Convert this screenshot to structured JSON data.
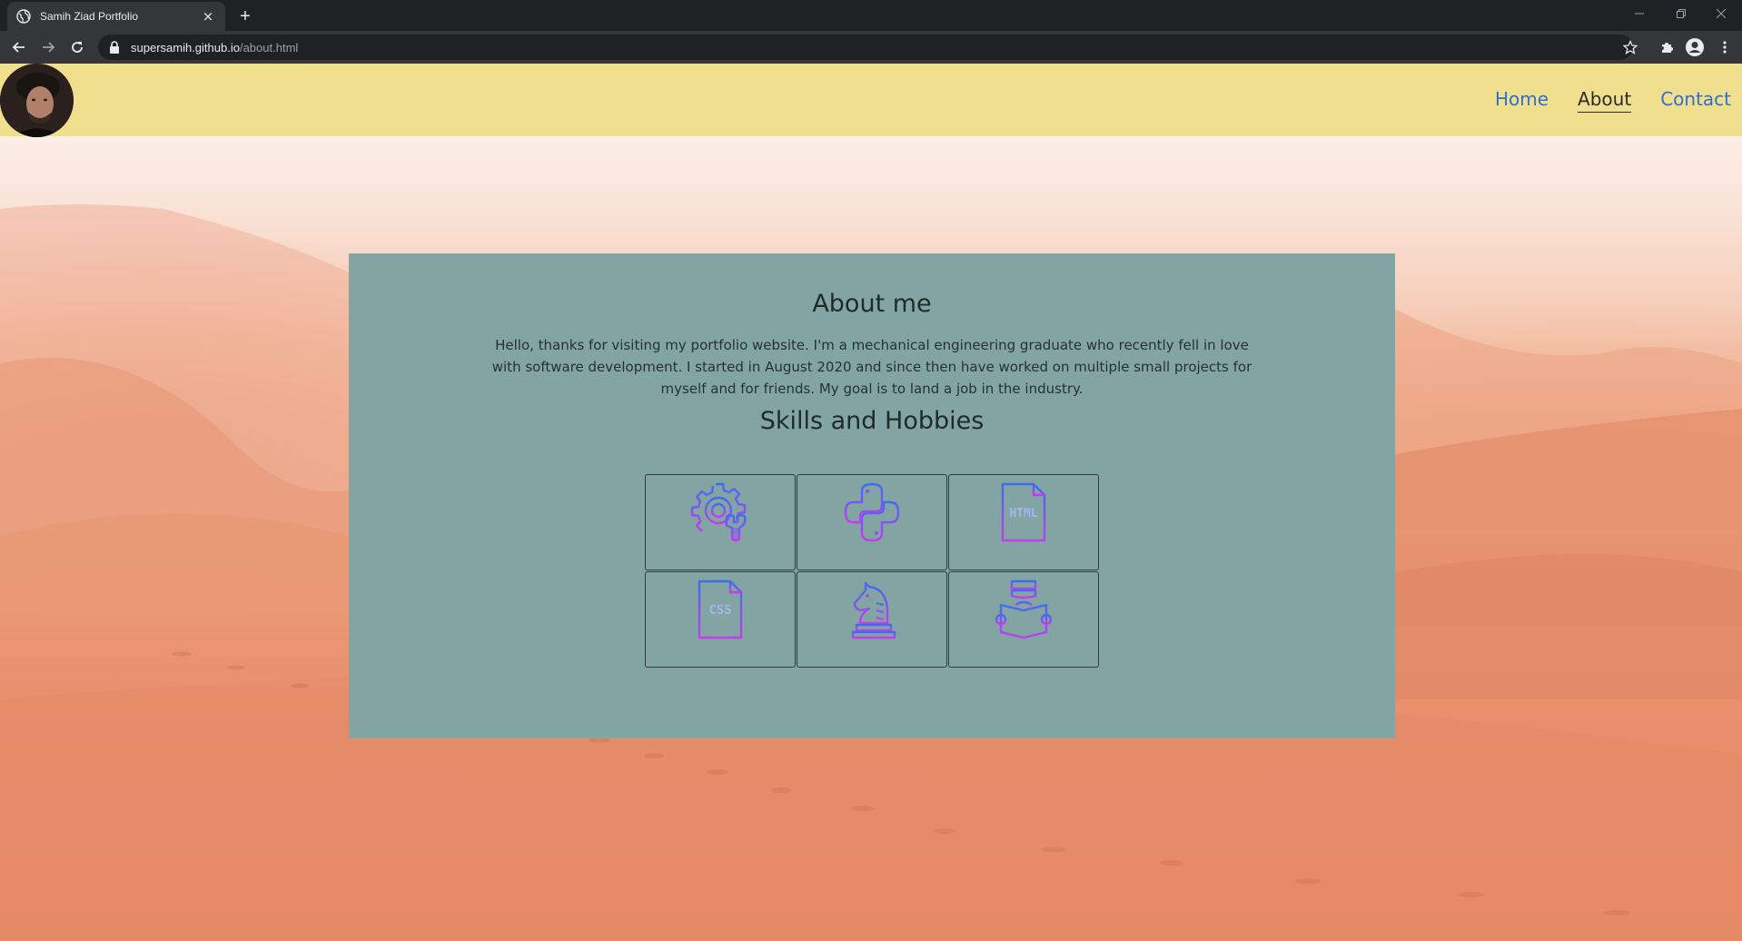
{
  "browser": {
    "tab_title": "Samih Ziad Portfolio",
    "url_host": "supersamih.github.io",
    "url_path": "/about.html"
  },
  "navbar": {
    "links": [
      {
        "label": "Home",
        "active": false
      },
      {
        "label": "About",
        "active": true
      },
      {
        "label": "Contact",
        "active": false
      }
    ]
  },
  "about": {
    "title": "About me",
    "text": "Hello, thanks for visiting my portfolio website. I'm a mechanical engineering graduate who recently fell in love with software development. I started in August 2020 and since then have worked on multiple small projects for myself and for friends. My goal is to land a job in the industry."
  },
  "skills": {
    "title": "Skills and Hobbies",
    "items": [
      {
        "icon": "engineering-gear-wrench-icon",
        "html_label": "",
        "css_label": ""
      },
      {
        "icon": "python-icon"
      },
      {
        "icon": "html-file-icon",
        "label": "HTML"
      },
      {
        "icon": "css-file-icon",
        "label": "CSS"
      },
      {
        "icon": "chess-knight-icon"
      },
      {
        "icon": "reading-person-icon"
      }
    ]
  },
  "colors": {
    "navbar": "#f0df8c",
    "card": "#82a4a2",
    "link": "#2f6fd1",
    "icon_gradient_start": "#3f6df0",
    "icon_gradient_end": "#c43cf0"
  }
}
